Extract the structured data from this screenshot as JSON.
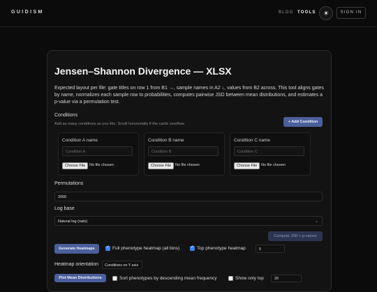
{
  "header": {
    "brand": "GUIDISM",
    "nav": [
      "BLOG",
      "TOOLS"
    ],
    "theme_icon": "sun-icon",
    "signin": "SIGN IN"
  },
  "main": {
    "title": "Jensen–Shannon Divergence — XLSX",
    "description": "Expected layout per file: gate titles on row 1 from B1 →, sample names in A2 ↓, values from B2 across. This tool aligns gates by name, normalizes each sample row to probabilities, computes pairwise JSD between mean distributions, and estimates a p-value via a permutation test.",
    "conditions": {
      "heading": "Conditions",
      "hint": "Add as many conditions as you like. Scroll horizontally if the cards overflow.",
      "add_button": "+ Add Condition",
      "items": [
        {
          "title": "Condition A name",
          "placeholder": "Condition A",
          "file_button": "Choose File",
          "file_status": "No file chosen"
        },
        {
          "title": "Condition B name",
          "placeholder": "Condition B",
          "file_button": "Choose File",
          "file_status": "No file chosen"
        },
        {
          "title": "Condition C name",
          "placeholder": "Condition C",
          "file_button": "Choose File",
          "file_status": "No file chosen"
        }
      ]
    },
    "permutations": {
      "label": "Permutations",
      "value": "2000"
    },
    "log_base": {
      "label": "Log base",
      "value": "Natural log (nats)"
    },
    "compute_button": "Compute JSD + p-values",
    "heatmaps": {
      "generate_button": "Generate Heatmaps",
      "full_label": "Full phenotype heatmap (all bins)",
      "full_checked": true,
      "top_label": "Top phenotype heatmap",
      "top_checked": true,
      "top_value": "5"
    },
    "orientation": {
      "label": "Heatmap orientation",
      "value": "Conditions on Y axis"
    },
    "mean_dist": {
      "button": "Plot Mean Distributions",
      "sort_label": "Sort phenotypes by descending mean frequency",
      "sort_checked": false,
      "show_only_label": "Show only top",
      "show_only_checked": false,
      "show_only_value": "20"
    }
  }
}
